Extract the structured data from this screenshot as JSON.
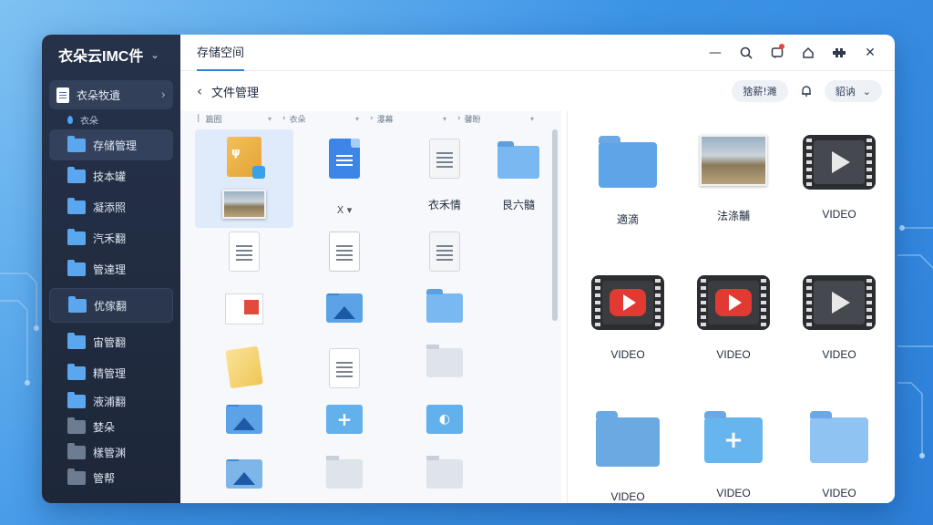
{
  "app": {
    "title": "衣朵云IMC件"
  },
  "sidebar": {
    "top_item": "衣朵牧遺",
    "sub_item": "衣朵",
    "items": [
      {
        "label": "存储管理",
        "active": true
      },
      {
        "label": "技本罐"
      },
      {
        "label": "凝添照"
      },
      {
        "label": "汽禾翻"
      },
      {
        "label": "管達理"
      },
      {
        "label": "优傢翻"
      },
      {
        "label": "宙管翻"
      },
      {
        "label": "精管理"
      },
      {
        "label": "液浦翻"
      },
      {
        "label": "婪朵"
      },
      {
        "label": "樣管渊"
      },
      {
        "label": "管帮"
      }
    ]
  },
  "topbar": {
    "tab_label": "存储空间"
  },
  "window_icons": [
    "minimize-icon",
    "search-icon",
    "notification-icon",
    "home-icon",
    "plugin-icon",
    "close-icon"
  ],
  "subbar": {
    "page_title": "文件管理",
    "filter_pill": "猞薪!濉",
    "sort_label": "貂讷"
  },
  "columns": [
    "篇囿",
    "衣朵",
    "瀑幕",
    "馨盼"
  ],
  "grid": {
    "labels": {
      "c1": "衣禾情",
      "c2": "艮六髓",
      "c0": "Ⅹ"
    }
  },
  "right": {
    "labels": [
      "適滴",
      "法涤黼",
      "VIDEO",
      "VIDEO",
      "VIDEO",
      "VIDEO",
      "VIDEO",
      "VIDEO",
      "VIDEO"
    ]
  },
  "colors": {
    "accent": "#2f7fe0",
    "sidebar_bg": "#1d2739",
    "red_dot": "#e5483e"
  }
}
